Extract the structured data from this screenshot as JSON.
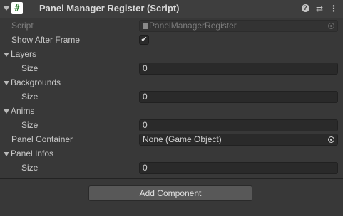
{
  "header": {
    "title": "Panel Manager Register (Script)",
    "script_icon_glyph": "#",
    "fold_icon": "triangle-down-icon",
    "help_icon": "help-icon",
    "preset_icon": "preset-sliders-icon",
    "menu_icon": "kebab-menu-icon",
    "help_glyph": "?",
    "preset_glyph": "⇄",
    "menu_glyph": "⋮"
  },
  "fields": {
    "script": {
      "label": "Script",
      "value": "PanelManagerRegister"
    },
    "show_after_frame": {
      "label": "Show After Frame",
      "checked": true,
      "check_glyph": "✔"
    },
    "layers": {
      "label": "Layers",
      "size_label": "Size",
      "size_value": "0"
    },
    "backgrounds": {
      "label": "Backgrounds",
      "size_label": "Size",
      "size_value": "0"
    },
    "anims": {
      "label": "Anims",
      "size_label": "Size",
      "size_value": "0"
    },
    "panel_container": {
      "label": "Panel Container",
      "value": "None (Game Object)"
    },
    "panel_infos": {
      "label": "Panel Infos",
      "size_label": "Size",
      "size_value": "0"
    }
  },
  "footer": {
    "add_component_label": "Add Component"
  },
  "colors": {
    "background": "#383838",
    "header": "#3e3e3e",
    "field": "#2a2a2a",
    "button": "#585858",
    "text": "#c8c8c8"
  }
}
